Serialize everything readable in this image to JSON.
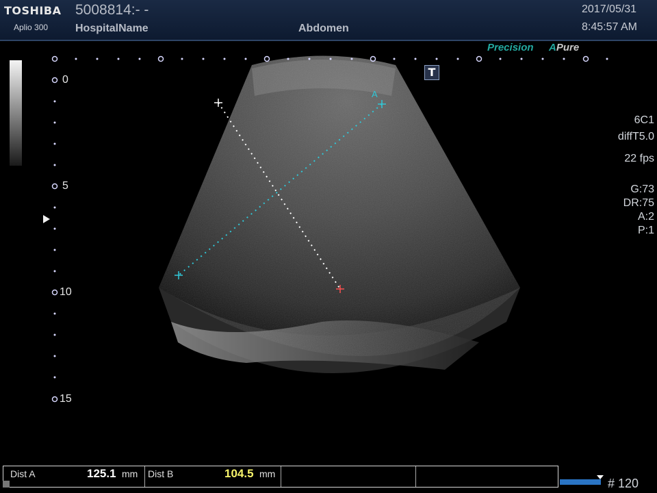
{
  "header": {
    "brand": "TOSHIBA",
    "model": "Aplio 300",
    "patient_id": "5008814:- -",
    "hospital": "HospitalName",
    "exam": "Abdomen",
    "date": "2017/05/31",
    "time": "8:45:57 AM"
  },
  "modes": {
    "precision_prefix": "Precision",
    "apure_letter": "A",
    "apure_text": "Pure"
  },
  "icons": {
    "text_tool": "T"
  },
  "probe_info": {
    "transducer": "6C1",
    "preset": "diffT5.0",
    "frame_rate": "22 fps",
    "gain": "G:73",
    "dynamic_range": "DR:75",
    "a_value": "A:2",
    "p_value": "P:1"
  },
  "depth_scale": {
    "labels": [
      "0",
      "5",
      "10",
      "15"
    ]
  },
  "caliper_labels": {
    "a": "A"
  },
  "measurements": {
    "dist_a_label": "Dist A",
    "dist_a_value": "125.1",
    "dist_a_unit": "mm",
    "dist_b_label": "Dist B",
    "dist_b_value": "104.5",
    "dist_b_unit": "mm"
  },
  "cine": {
    "frame_counter": "# 120"
  },
  "colors": {
    "accent_teal": "#23a9a0",
    "caliper_a": "#30c8d8",
    "caliper_b": "#ffffff",
    "dist_b_value": "#f6f36a"
  }
}
